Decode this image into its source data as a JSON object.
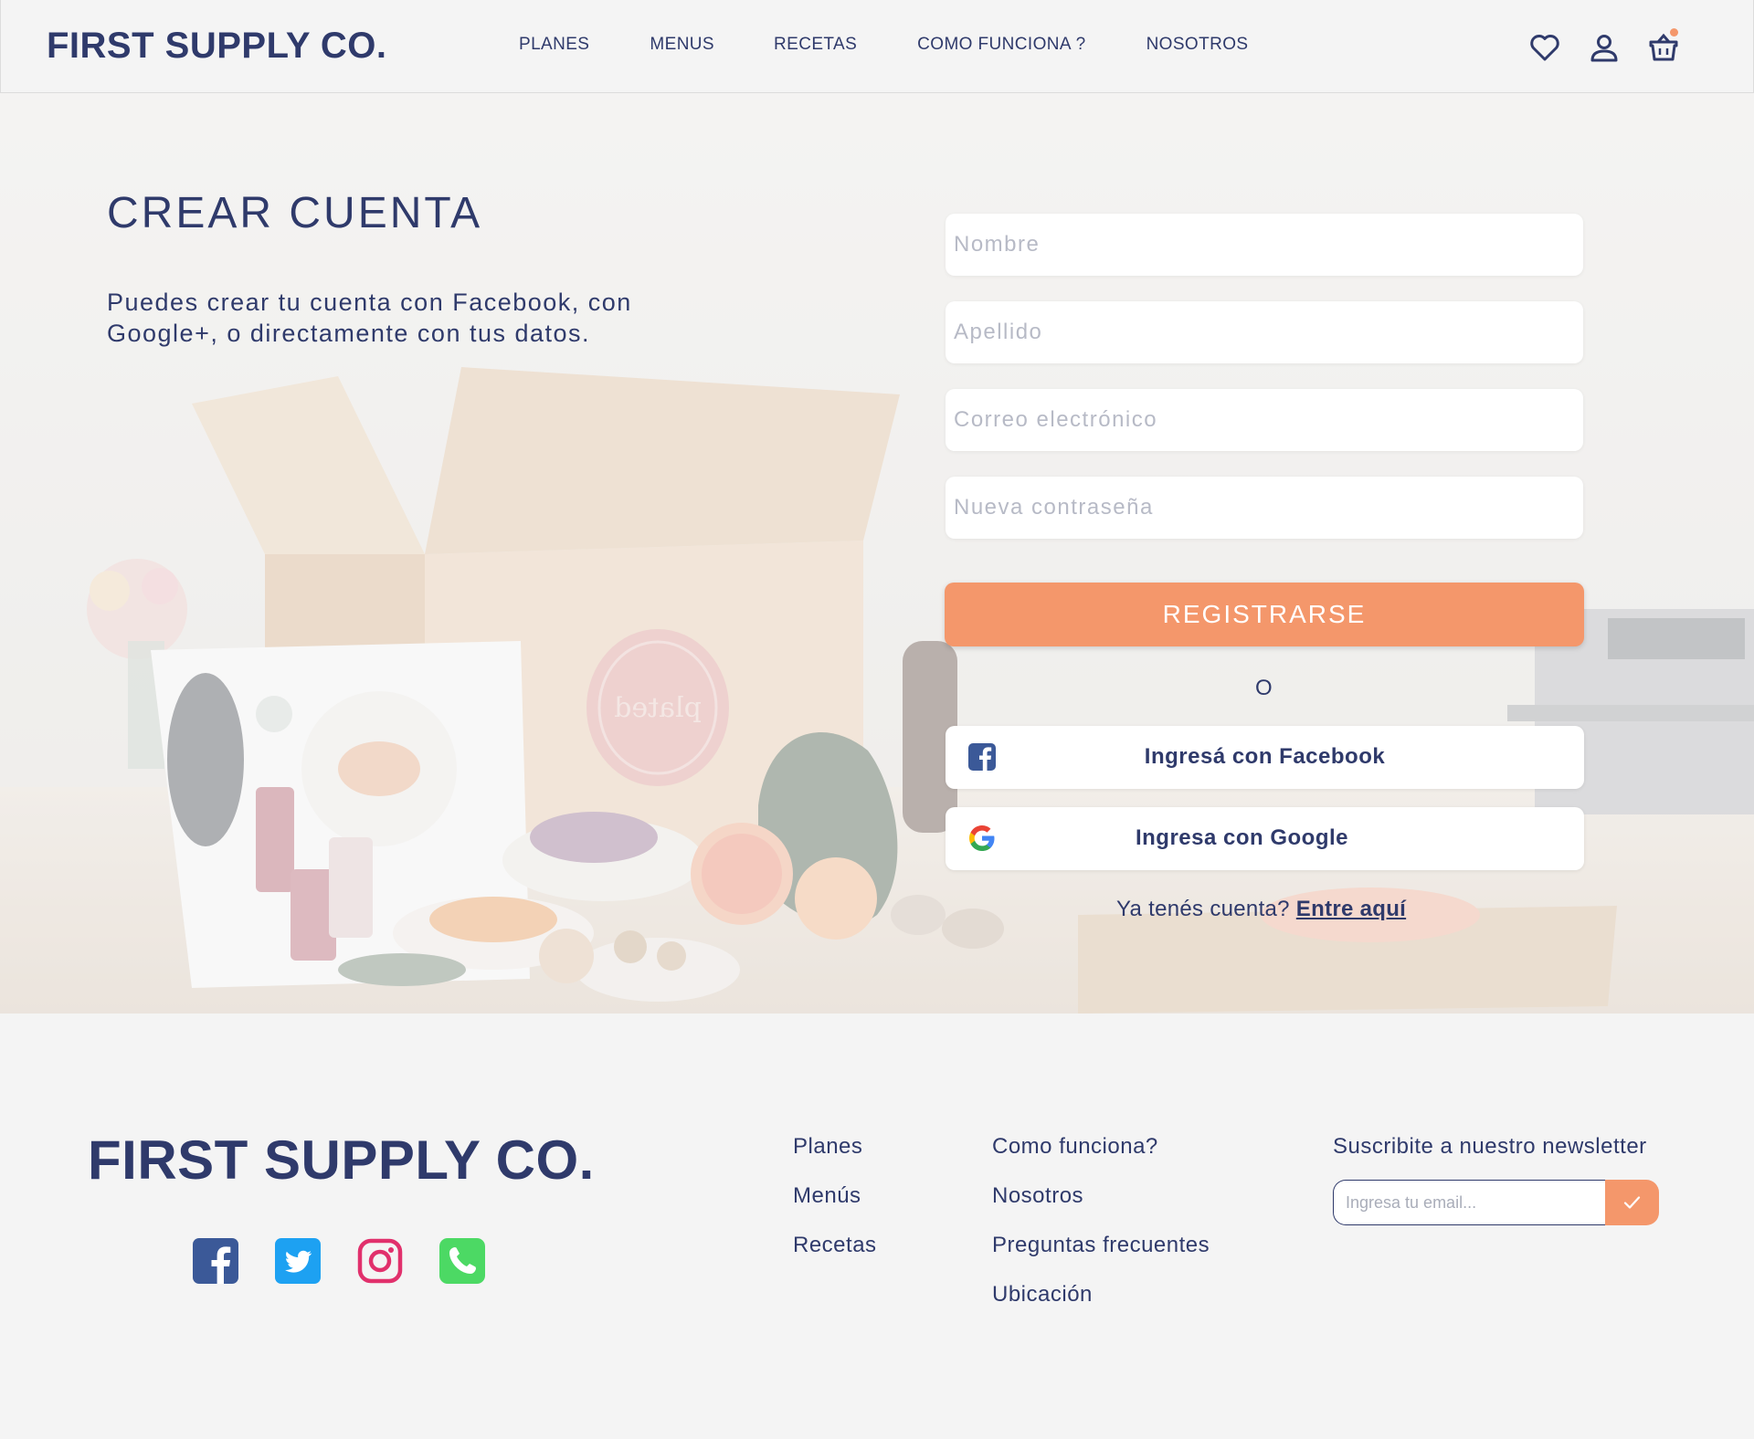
{
  "header": {
    "logo": "FIRST SUPPLY CO.",
    "nav": [
      "PLANES",
      "MENUS",
      "RECETAS",
      "COMO FUNCIONA ?",
      "NOSOTROS"
    ],
    "icons": [
      "heart-icon",
      "user-icon",
      "cart-icon"
    ]
  },
  "hero": {
    "title": "CREAR CUENTA",
    "subtitle": "Puedes crear tu cuenta con Facebook, con Google+, o directamente con tus datos.",
    "box_brand": "plated"
  },
  "form": {
    "name_placeholder": "Nombre",
    "lastname_placeholder": "Apellido",
    "email_placeholder": "Correo electrónico",
    "password_placeholder": "Nueva contraseña",
    "register_label": "REGISTRARSE",
    "or_label": "O",
    "facebook_label": "Ingresá con Facebook",
    "google_label": "Ingresa con Google",
    "have_account_text": "Ya tenés cuenta?",
    "login_link": "Entre aquí"
  },
  "footer": {
    "logo": "FIRST SUPPLY CO.",
    "social": [
      "facebook-icon",
      "twitter-icon",
      "instagram-icon",
      "phone-icon"
    ],
    "col1": [
      "Planes",
      "Menús",
      "Recetas"
    ],
    "col2": [
      "Como funciona?",
      "Nosotros",
      "Preguntas frecuentes",
      "Ubicación"
    ],
    "newsletter_title": "Suscribite a nuestro newsletter",
    "newsletter_placeholder": "Ingresa tu email..."
  },
  "colors": {
    "primary": "#2f3a6b",
    "accent": "#f4976b",
    "background": "#f4f4f4"
  }
}
